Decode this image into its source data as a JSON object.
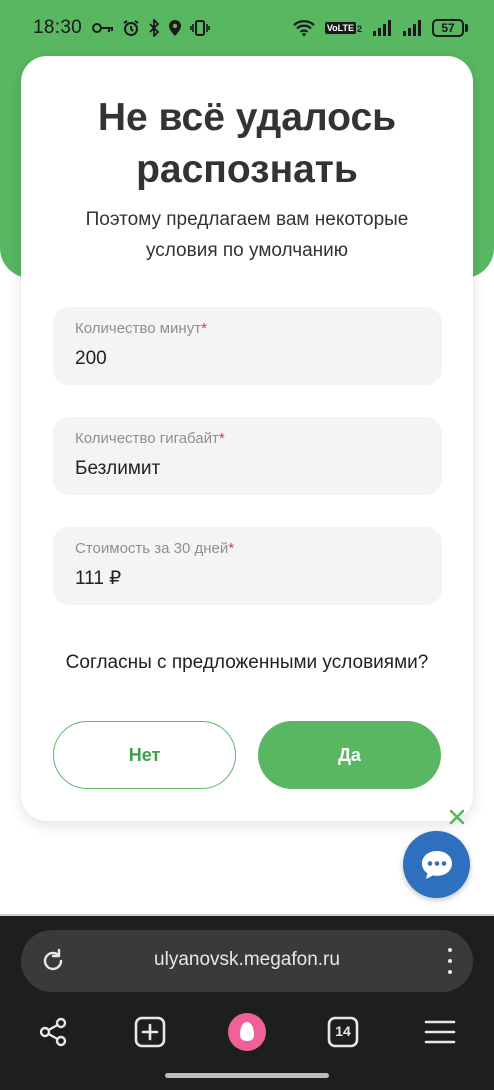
{
  "status_bar": {
    "time": "18:30",
    "volte_label": "VoLTE",
    "volte_sub": "2",
    "battery": "57"
  },
  "dialog": {
    "title": "Не всё удалось распознать",
    "subtitle": "Поэтому предлагаем вам некоторые условия по умолчанию",
    "fields": [
      {
        "label": "Количество минут",
        "required_mark": "*",
        "value": "200"
      },
      {
        "label": "Количество гигабайт",
        "required_mark": "*",
        "value": "Безлимит"
      },
      {
        "label": "Стоимость за 30 дней",
        "required_mark": "*",
        "value": "111 ₽"
      }
    ],
    "question": "Согласны с предложенными условиями?",
    "no_label": "Нет",
    "yes_label": "Да"
  },
  "chat": {
    "close_icon": "close-icon",
    "icon": "chat-bubble-icon"
  },
  "browser": {
    "url": "ulyanovsk.megafon.ru",
    "tab_count": "14",
    "nav_icons": [
      "share-icon",
      "new-tab-icon",
      "alice-icon",
      "tabs-icon",
      "menu-icon"
    ]
  },
  "colors": {
    "brand_green": "#59b762",
    "chat_blue": "#2e6fbf",
    "required_red": "#e53935"
  }
}
